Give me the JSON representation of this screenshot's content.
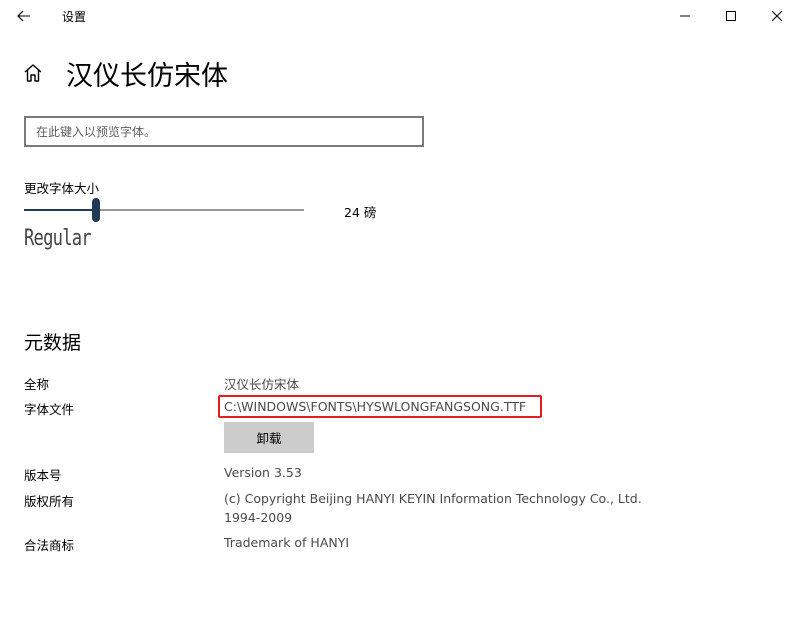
{
  "window": {
    "title": "设置"
  },
  "icons": {
    "back": "arrow-left-icon",
    "minimize": "minimize-icon",
    "maximize": "maximize-icon",
    "close": "close-icon",
    "home": "home-icon"
  },
  "page": {
    "title": "汉仪长仿宋体"
  },
  "preview": {
    "placeholder": "在此键入以预览字体。",
    "value": ""
  },
  "font_size": {
    "label": "更改字体大小",
    "value_text": "24 磅",
    "slider_fraction": 0.257,
    "sample": "Regular"
  },
  "metadata": {
    "section_title": "元数据",
    "full_name": {
      "label": "全称",
      "value": "汉仪长仿宋体"
    },
    "font_file": {
      "label": "字体文件",
      "value": "C:\\WINDOWS\\FONTS\\HYSWLONGFANGSONG.TTF"
    },
    "uninstall_label": "卸载",
    "version": {
      "label": "版本号",
      "value": "Version 3.53"
    },
    "copyright": {
      "label": "版权所有",
      "value_line1": "(c) Copyright Beijing HANYI KEYIN Information Technology Co., Ltd.",
      "value_line2": "1994-2009"
    },
    "trademark": {
      "label": "合法商标",
      "value": "Trademark of HANYI"
    }
  },
  "colors": {
    "accent": "#1f3a55",
    "highlight_box": "#e02020",
    "button_bg": "#cccccc"
  }
}
